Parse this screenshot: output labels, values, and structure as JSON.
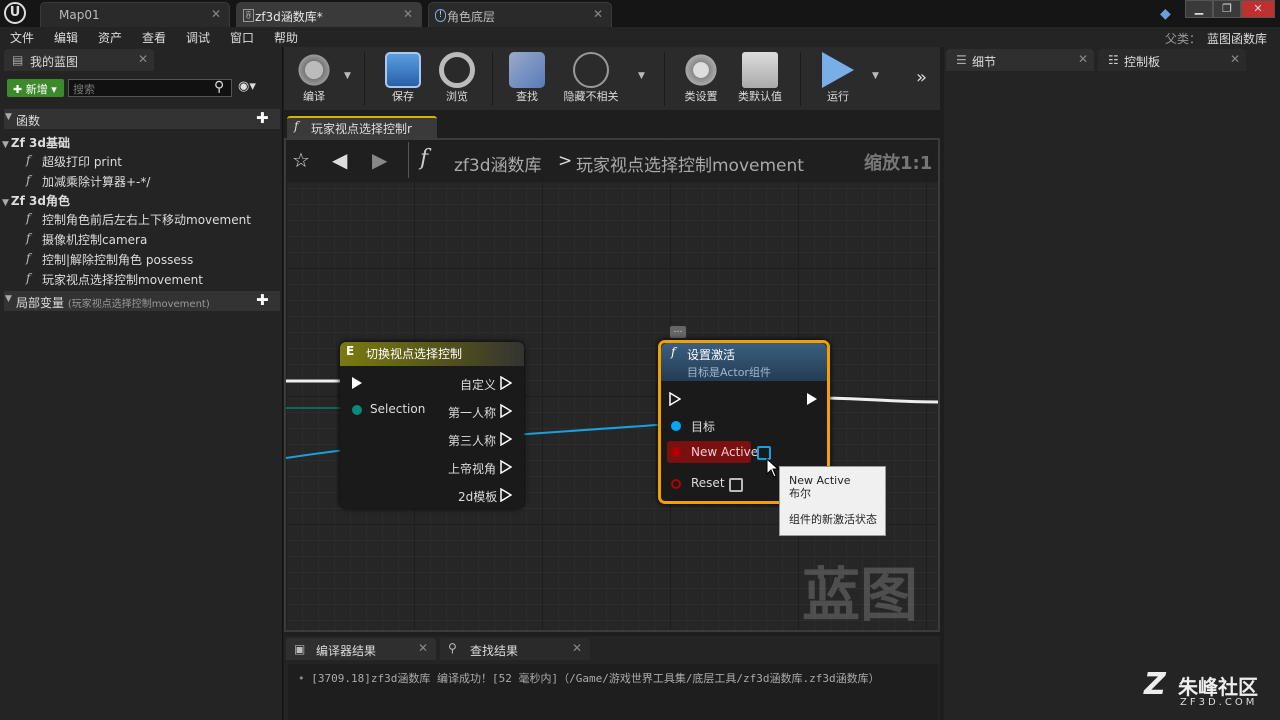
{
  "tabs": [
    "Map01",
    "zf3d涵数库*",
    "角色底层"
  ],
  "menu": [
    "文件",
    "编辑",
    "资产",
    "查看",
    "调试",
    "窗口",
    "帮助"
  ],
  "parent": {
    "label": "父类：",
    "value": "蓝图函数库"
  },
  "left_panel": {
    "title": "我的蓝图",
    "add_label": "新增",
    "search_placeholder": "搜索",
    "functions_header": "函数",
    "groups": [
      {
        "name": "Zf 3d基础",
        "items": [
          "超级打印 print",
          "加减乘除计算器+-*/"
        ]
      },
      {
        "name": "Zf 3d角色",
        "items": [
          "控制角色前后左右上下移动movement",
          "摄像机控制camera",
          "控制|解除控制角色 possess",
          "玩家视点选择控制movement"
        ]
      }
    ],
    "local_vars": "局部变量",
    "local_vars_hint": "(玩家视点选择控制movement)"
  },
  "toolbar": [
    "编译",
    "保存",
    "浏览",
    "查找",
    "隐藏不相关",
    "类设置",
    "类默认值",
    "运行"
  ],
  "graph_tab": "玩家视点选择控制r",
  "breadcrumb": {
    "root": "zf3d涵数库",
    "sep": ">",
    "current": "玩家视点选择控制movement",
    "zoom": "缩放1:1"
  },
  "node_switch": {
    "title": "切换视点选择控制",
    "input_pin": "Selection",
    "outputs": [
      "自定义",
      "第一人称",
      "第三人称",
      "上帝视角",
      "2d模板"
    ]
  },
  "node_set": {
    "title": "设置激活",
    "subtitle": "目标是Actor组件",
    "pins": [
      "目标",
      "New Active",
      "Reset"
    ]
  },
  "tooltip": {
    "name": "New Active",
    "type": "布尔",
    "desc": "组件的新激活状态"
  },
  "watermark": "蓝图",
  "right_panel": {
    "details": "细节",
    "palette": "控制板"
  },
  "bottom": {
    "tabs": [
      "编译器结果",
      "查找结果"
    ],
    "log": "[3709.18]zf3d涵数库 编译成功！[52 毫秒内]（/Game/游戏世界工具集/底层工具/zf3d涵数库.zf3d涵数库）"
  },
  "brand": {
    "name": "朱峰社区",
    "url": "ZF3D.COM"
  },
  "colors": {
    "exec": "#ffffff",
    "bool": "#8c0000",
    "object": "#00a8f4",
    "byte": "#006f65",
    "selected": "#f0a000"
  }
}
